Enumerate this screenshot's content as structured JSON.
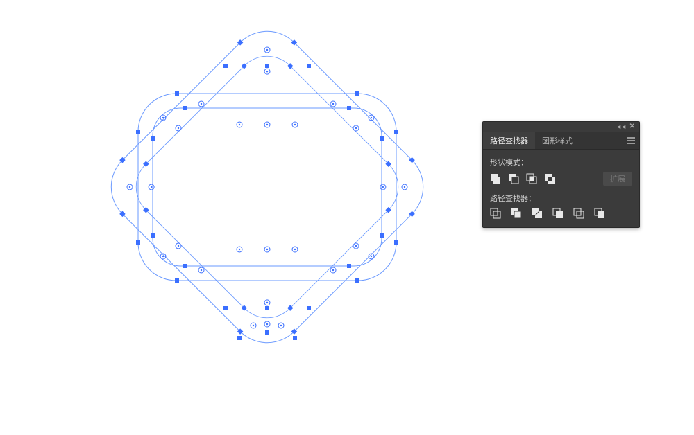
{
  "panel": {
    "tabs": {
      "pathfinder": "路径查找器",
      "graphic_styles": "图形样式"
    },
    "section_shape_modes": "形状模式：",
    "section_pathfinders": "路径查找器：",
    "expand_label": "扩展",
    "icon_names": {
      "unite": "unite-icon",
      "minus_front": "minus-front-icon",
      "intersect": "intersect-icon",
      "exclude": "exclude-icon",
      "divide": "divide-icon",
      "trim": "trim-icon",
      "merge": "merge-icon",
      "crop": "crop-icon",
      "outline": "outline-icon",
      "minus_back": "minus-back-icon"
    }
  },
  "artwork": {
    "description": "Two rotated rounded-square stroke paths, selected, showing anchor points, direction handles and center-point markers",
    "stroke_color": "#5a8cff",
    "anchor_fill": "#3b6fff"
  }
}
